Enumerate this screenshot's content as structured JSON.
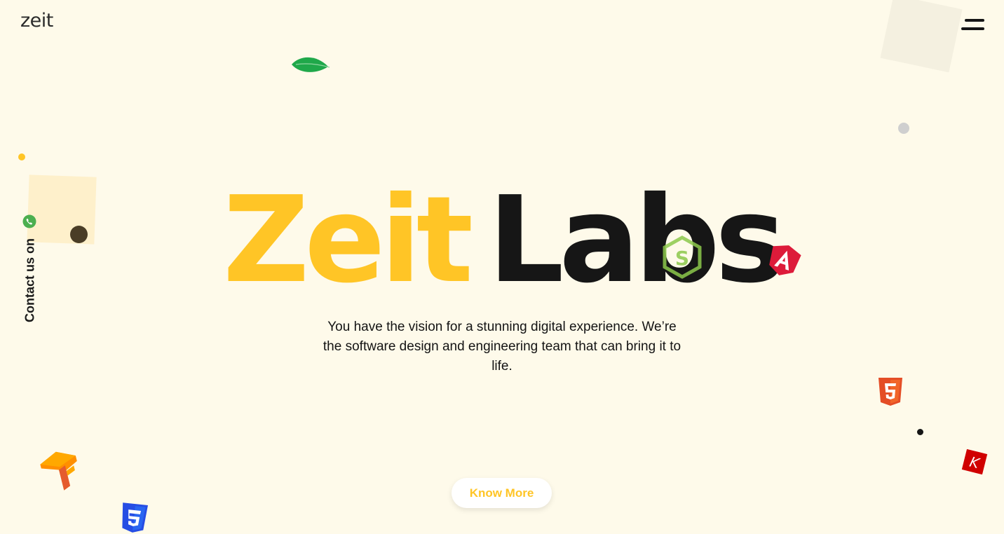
{
  "header": {
    "logo_text": "zeit",
    "menu_icon": "hamburger-menu-icon"
  },
  "hero": {
    "title_word1": "Zeit",
    "title_word2": "Labs",
    "subtitle": "You have the vision for a stunning digital experience. We’re the software design and engineering team that can bring it to life.",
    "cta_label": "Know More"
  },
  "sidebar": {
    "contact_label": "Contact us on",
    "contact_icon": "whatsapp-icon"
  },
  "decorations": {
    "icons": [
      "leaf-icon",
      "nodejs-icon",
      "angular-icon",
      "html5-icon",
      "keras-icon",
      "tensorflow-icon",
      "css3-icon"
    ]
  },
  "colors": {
    "background": "#fefaea",
    "accent_yellow": "#ffc526",
    "text_dark": "#161616",
    "angular_red": "#dd1b3a",
    "html5_orange": "#e44d26",
    "css3_blue": "#264de4",
    "keras_red": "#d00000",
    "leaf_green": "#1fa84a",
    "whatsapp_green": "#4caf50"
  }
}
